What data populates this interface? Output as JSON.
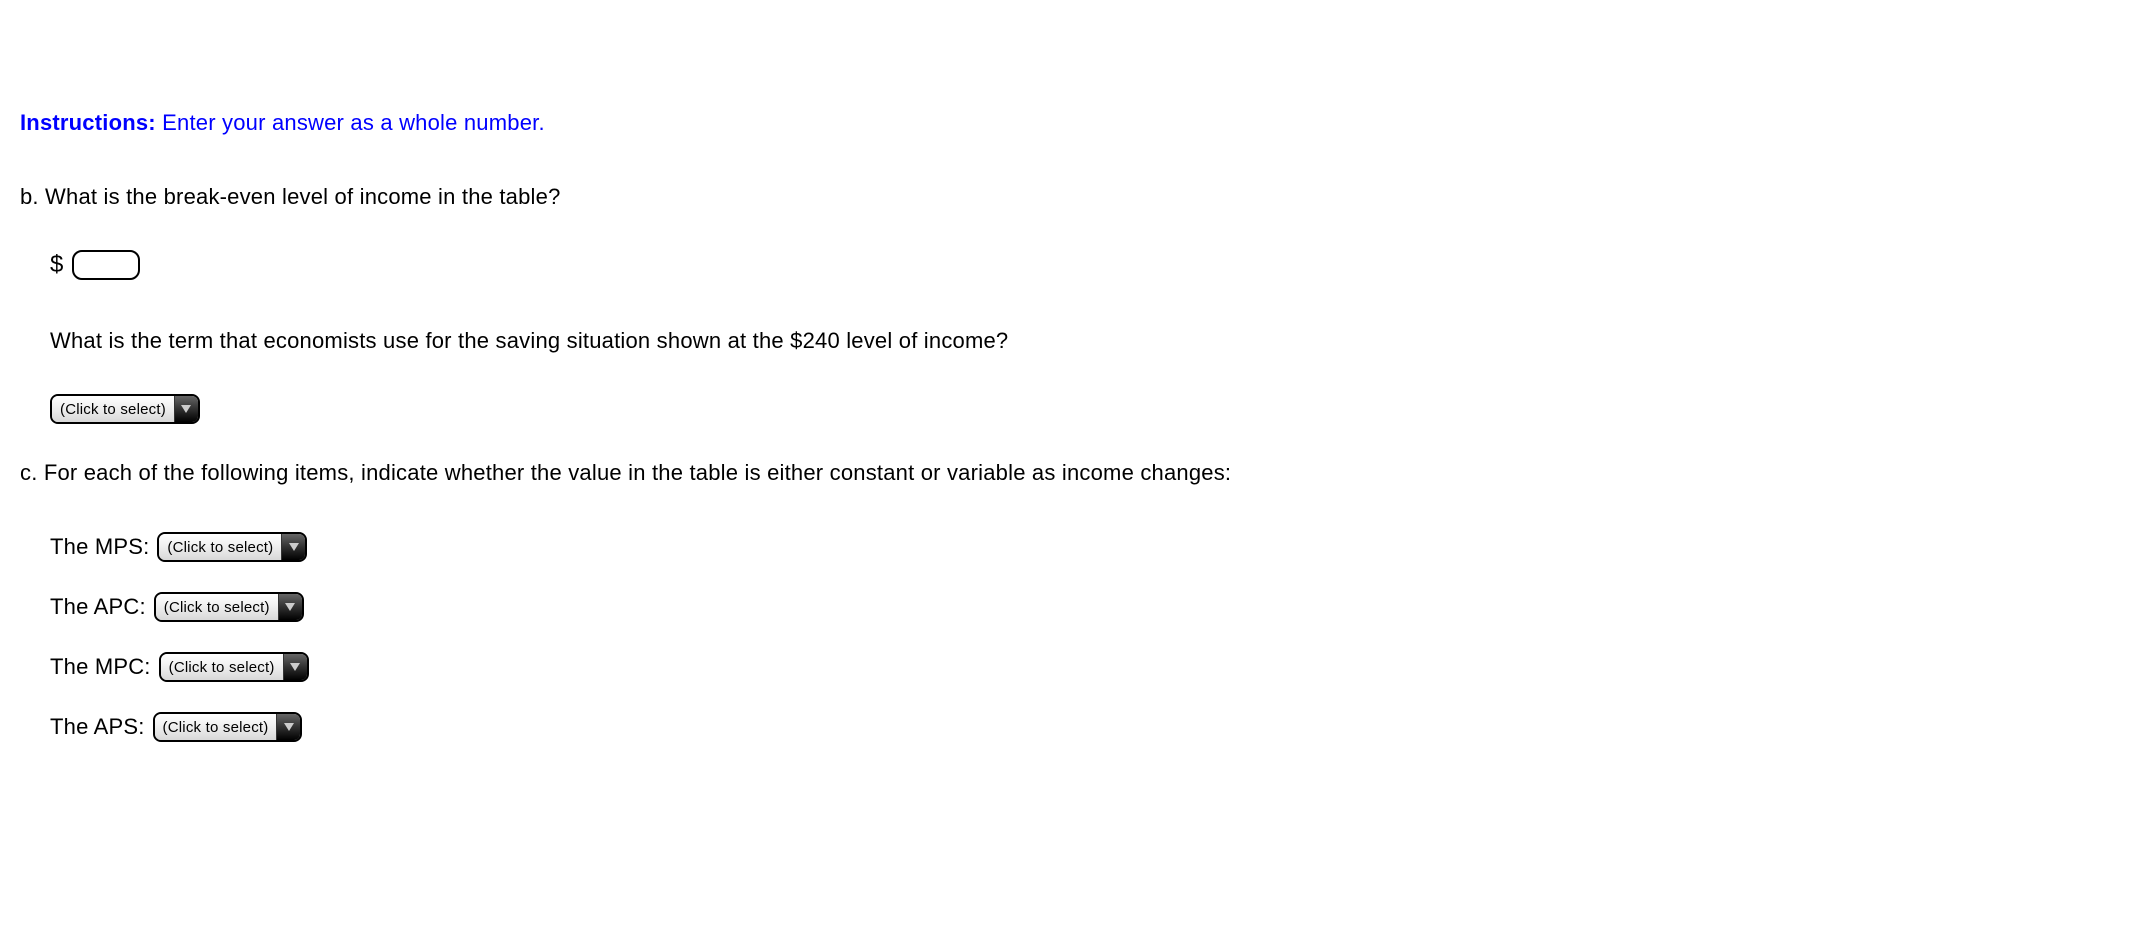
{
  "instructions": {
    "label": "Instructions:",
    "text": "Enter your answer as a whole number."
  },
  "questionB": {
    "prompt": "b. What is the break-even level of income in the table?",
    "currency": "$",
    "subPrompt": "What is the term that economists use for the saving situation shown at the $240 level of income?",
    "dropdownPlaceholder": "(Click to select)"
  },
  "questionC": {
    "prompt": "c. For each of the following items, indicate whether the value in the table is either constant or variable as income changes:",
    "items": [
      {
        "label": "The MPS:",
        "placeholder": "(Click to select)"
      },
      {
        "label": "The APC:",
        "placeholder": "(Click to select)"
      },
      {
        "label": "The MPC:",
        "placeholder": "(Click to select)"
      },
      {
        "label": "The APS:",
        "placeholder": "(Click to select)"
      }
    ]
  }
}
